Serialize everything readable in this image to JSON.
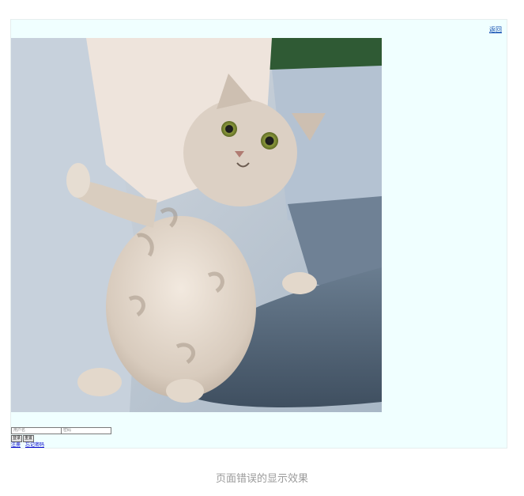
{
  "header": {
    "back_label": "返回"
  },
  "image": {
    "subject": "cat-photo"
  },
  "login_form": {
    "username_placeholder": "用户名",
    "password_placeholder": "密码",
    "login_button": "登录",
    "reset_button": "重置",
    "register_link": "注册",
    "forgot_password_link": "忘记密码"
  },
  "caption": "页面错误的显示效果",
  "colors": {
    "frame_bg": "#f0ffff",
    "page_bg": "#ffffff",
    "link": "#0000cc",
    "caption": "#9a9a9a"
  }
}
